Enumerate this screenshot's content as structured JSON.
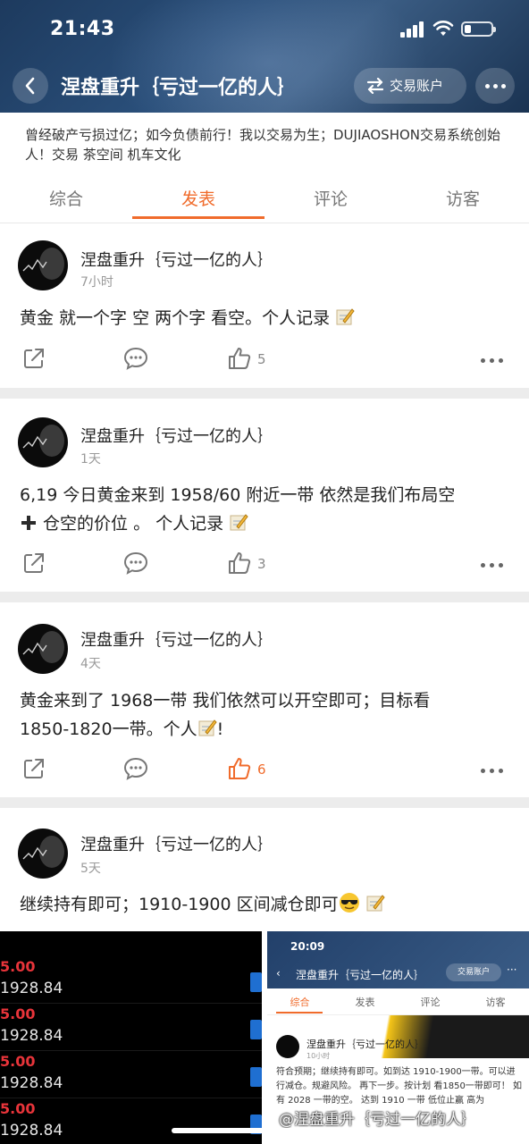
{
  "status_bar": {
    "time": "21:43"
  },
  "nav": {
    "title": "涅盘重升｛亏过一亿的人｝",
    "trade_label": "交易账户",
    "icons": [
      "back-arrow-icon",
      "swap-icon",
      "more-dots-icon"
    ]
  },
  "bio": "曾经破产亏损过亿；如今负债前行！我以交易为生；DUJIAOSHON交易系统创始人！交易 茶空间 机车文化",
  "tabs": [
    {
      "label": "综合",
      "active": false
    },
    {
      "label": "发表",
      "active": true
    },
    {
      "label": "评论",
      "active": false
    },
    {
      "label": "访客",
      "active": false
    }
  ],
  "posts": [
    {
      "author": "涅盘重升｛亏过一亿的人｝",
      "time": "7小时",
      "text": "黄金 就一个字 空 两个字 看空。个人记录",
      "likes": "5",
      "liked": false
    },
    {
      "author": "涅盘重升｛亏过一亿的人｝",
      "time": "1天",
      "text1": "6,19 今日黄金来到 1958/60 附近一带 依然是我们布局空",
      "text2": "仓空的价位 。 个人记录",
      "likes": "3",
      "liked": false
    },
    {
      "author": "涅盘重升｛亏过一亿的人｝",
      "time": "4天",
      "text1": "黄金来到了 1968一带 我们依然可以开空即可；目标看",
      "text2": "1850-1820一带。个人",
      "text2_end": "!",
      "likes": "6",
      "liked": true
    },
    {
      "author": "涅盘重升｛亏过一亿的人｝",
      "time": "5天",
      "text": "继续持有即可；1910-1900 区间减仓即可"
    }
  ],
  "image_left": {
    "rows": [
      {
        "red": "5.00",
        "price": "1928.84"
      },
      {
        "red": "5.00",
        "price": "1928.84"
      },
      {
        "red": "5.00",
        "price": "1928.84"
      },
      {
        "red": "5.00",
        "price": "1928.84"
      }
    ],
    "colors": {
      "red": "#e8343a",
      "blue": "#1f6fd1"
    }
  },
  "image_right": {
    "time": "20:09",
    "title": "涅盘重升｛亏过一亿的人｝",
    "trade_label": "交易账户",
    "tabs": [
      "综合",
      "发表",
      "评论",
      "访客"
    ],
    "author": "涅盘重升｛亏过一亿的人｝",
    "post_time": "10小时",
    "text": "符合预期；继续持有即可。如到达 1910-1900一带。可以进行减仓。规避风险。 再下一步。按计划 看1850一带即可！ 如有 2028 一带的空。 达到 1910 一带 低位止赢 高为"
  },
  "watermark": "@涅盘重升｛亏过一亿的人｝",
  "colors": {
    "accent": "#f06b2b",
    "header_bg": "#2a4f7a"
  }
}
